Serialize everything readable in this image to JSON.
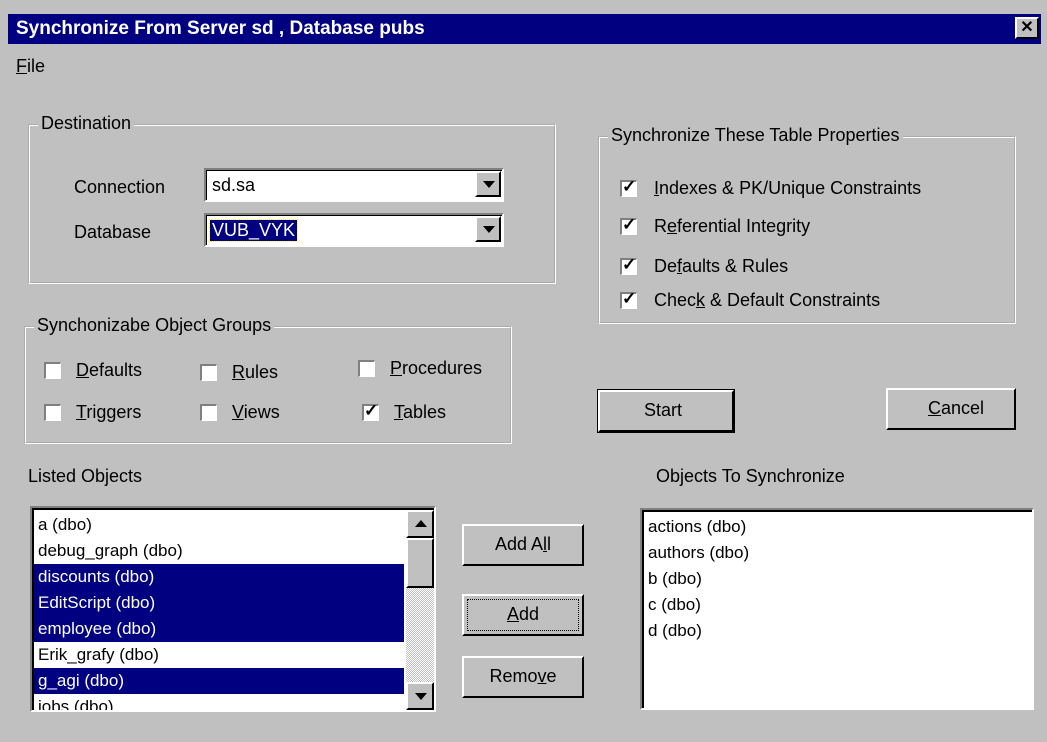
{
  "window": {
    "title": "Synchronize From Server sd , Database pubs",
    "close_glyph": "✕"
  },
  "menu": {
    "file_u": "F",
    "file_rest": "ile"
  },
  "destination": {
    "label": "Destination",
    "connection_label": "Connection",
    "connection_value": "sd.sa",
    "database_label": "Database",
    "database_value": "VUB_VYK"
  },
  "table_properties": {
    "label": "Synchronize These Table Properties",
    "items": [
      {
        "pre": "",
        "u": "I",
        "post": "ndexes & PK/Unique Constraints",
        "checked": true
      },
      {
        "pre": "R",
        "u": "e",
        "post": "ferential Integrity",
        "checked": true
      },
      {
        "pre": "De",
        "u": "f",
        "post": "aults & Rules",
        "checked": true
      },
      {
        "pre": "Chec",
        "u": "k",
        "post": " & Default Constraints",
        "checked": true
      }
    ]
  },
  "object_groups": {
    "label": "Synchonizabe Object Groups",
    "defaults": {
      "u": "D",
      "post": "efaults",
      "checked": false
    },
    "rules": {
      "u": "R",
      "post": "ules",
      "checked": false
    },
    "procedures": {
      "u": "P",
      "post": "rocedures",
      "checked": false
    },
    "triggers": {
      "u": "T",
      "post": "riggers",
      "checked": false
    },
    "views": {
      "u": "V",
      "post": "iews",
      "checked": false
    },
    "tables": {
      "u": "T",
      "post": "ables",
      "checked": true
    }
  },
  "buttons": {
    "start": "Start",
    "cancel_u": "C",
    "cancel_rest": "ancel",
    "add_all_pre": "Add A",
    "add_all_u": "l",
    "add_all_post": "l",
    "add_u": "A",
    "add_rest": "dd",
    "remove_pre": "Remo",
    "remove_u": "v",
    "remove_post": "e"
  },
  "listed_objects": {
    "label": "Listed Objects",
    "items": [
      {
        "text": "a (dbo)",
        "selected": false
      },
      {
        "text": "debug_graph (dbo)",
        "selected": false
      },
      {
        "text": "discounts (dbo)",
        "selected": true
      },
      {
        "text": "EditScript (dbo)",
        "selected": true
      },
      {
        "text": "employee (dbo)",
        "selected": true
      },
      {
        "text": "Erik_grafy (dbo)",
        "selected": false
      },
      {
        "text": "g_agi (dbo)",
        "selected": true
      },
      {
        "text": "jobs (dbo)",
        "selected": false
      }
    ]
  },
  "objects_to_sync": {
    "label": "Objects To Synchronize",
    "items": [
      "actions (dbo)",
      "authors (dbo)",
      "b (dbo)",
      "c (dbo)",
      "d (dbo)"
    ]
  },
  "colors": {
    "selection": "#000080",
    "face": "#c0c0c0"
  }
}
